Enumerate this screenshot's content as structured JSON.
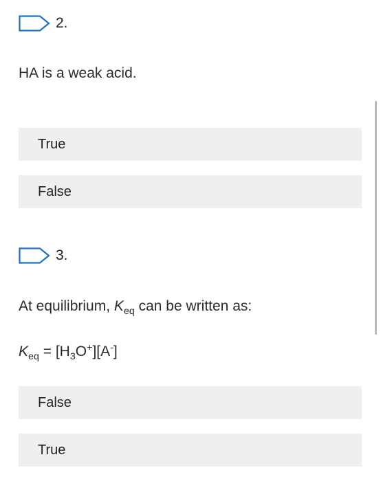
{
  "questions": [
    {
      "number": "2.",
      "flag_icon": "flag-outline-icon",
      "text": "HA is a weak acid.",
      "options": [
        "True",
        "False"
      ]
    },
    {
      "number": "3.",
      "flag_icon": "flag-outline-icon",
      "text_prefix": "At equilibrium, ",
      "text_k": "K",
      "text_sub": "eq",
      "text_suffix": " can be written as:",
      "equation": {
        "k": "K",
        "k_sub": "eq",
        "equals": " = [H",
        "h_sub": "3",
        "o": "O",
        "plus_sup": "+",
        "mid": "][A",
        "minus_sup": "-",
        "end": "]"
      },
      "options": [
        "False",
        "True"
      ]
    }
  ],
  "colors": {
    "flag_outline": "#1a73c9",
    "option_background": "#efefef",
    "scrollbar": "#b9b9b9"
  }
}
